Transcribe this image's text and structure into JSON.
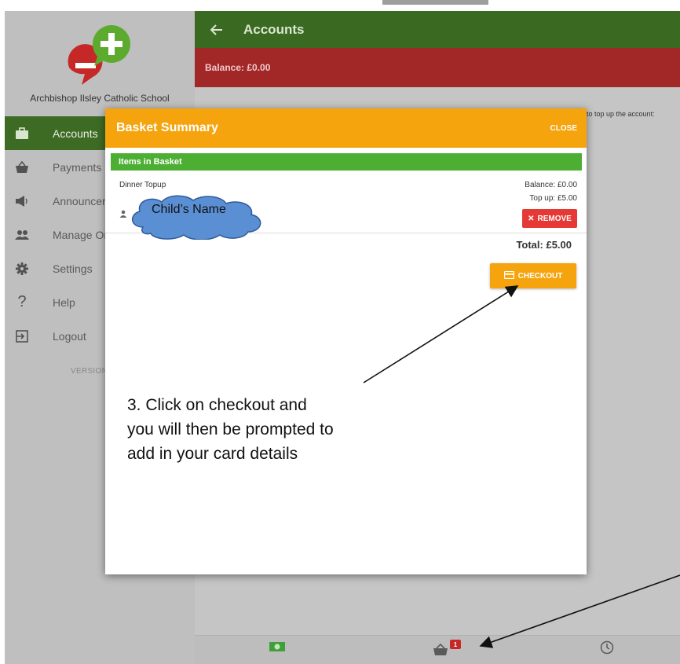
{
  "school": {
    "name": "Archbishop Ilsley Catholic School"
  },
  "nav": {
    "items": [
      {
        "label": "Accounts",
        "icon": "briefcase-icon"
      },
      {
        "label": "Payments",
        "icon": "basket-icon"
      },
      {
        "label": "Announcer",
        "icon": "megaphone-icon"
      },
      {
        "label": "Manage Or",
        "icon": "people-icon"
      },
      {
        "label": "Settings",
        "icon": "gear-icon"
      },
      {
        "label": "Help",
        "icon": "question-icon"
      },
      {
        "label": "Logout",
        "icon": "logout-icon"
      }
    ],
    "version": "VERSION"
  },
  "header": {
    "title": "Accounts",
    "balance": "Balance: £0.00",
    "hint": "w to top up the account:"
  },
  "modal": {
    "title": "Basket Summary",
    "close_label": "CLOSE",
    "items_header": "Items in Basket",
    "item": {
      "name": "Dinner Topup",
      "balance": "Balance: £0.00",
      "topup": "Top up: £5.00",
      "remove_label": "REMOVE"
    },
    "total": "Total: £5.00",
    "checkout_label": "CHECKOUT"
  },
  "annotation": {
    "cloud_text": "Child’s Name",
    "instruction_lines": [
      "3. Click on checkout and",
      "you will then be prompted to",
      "add in your card details"
    ]
  },
  "bottom_nav": {
    "basket_badge": "1"
  },
  "colors": {
    "green": "#3a6a22",
    "red": "#a22727",
    "orange": "#f5a40d",
    "items_green": "#4caf33",
    "remove_red": "#e53935"
  }
}
